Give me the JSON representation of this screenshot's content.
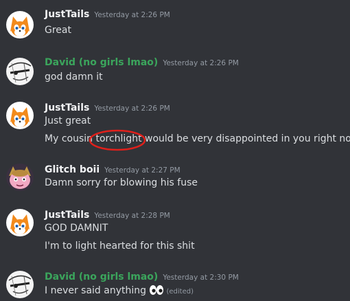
{
  "colors": {
    "background": "#313338",
    "justtails_name": "#f2f3f5",
    "david_name": "#3ba55c",
    "glitch_name": "#f2f3f5",
    "timestamp": "#949ba4",
    "annotation_circle": "#e0201b"
  },
  "messages": [
    {
      "author": "JustTails",
      "timestamp": "Yesterday at 2:26 PM",
      "avatar_icon": "fox-avatar-icon",
      "lines": [
        "Great"
      ]
    },
    {
      "author": "David (no girls lmao)",
      "timestamp": "Yesterday at 2:26 PM",
      "avatar_icon": "sketch-avatar-icon",
      "lines": [
        "god damn it"
      ]
    },
    {
      "author": "JustTails",
      "timestamp": "Yesterday at 2:26 PM",
      "avatar_icon": "fox-avatar-icon",
      "lines": [
        "Just great"
      ],
      "mentioned_line": {
        "before": "My cousin ",
        "highlight": "torchlight",
        "after": " would be very disappointed in you right now"
      }
    },
    {
      "author": "Glitch boii",
      "timestamp": "Yesterday at 2:27 PM",
      "avatar_icon": "pink-character-avatar-icon",
      "lines": [
        "Damn sorry for blowing his fuse"
      ]
    },
    {
      "author": "JustTails",
      "timestamp": "Yesterday at 2:28 PM",
      "avatar_icon": "fox-avatar-icon",
      "lines": [
        "GOD DAMNIT",
        "I'm to light hearted for this shit"
      ]
    },
    {
      "author": "David (no girls lmao)",
      "timestamp": "Yesterday at 2:30 PM",
      "avatar_icon": "sketch-avatar-icon",
      "lines": [
        "I never said anything"
      ],
      "emoji": "eyes-emoji",
      "edited_label": "(edited)"
    }
  ]
}
